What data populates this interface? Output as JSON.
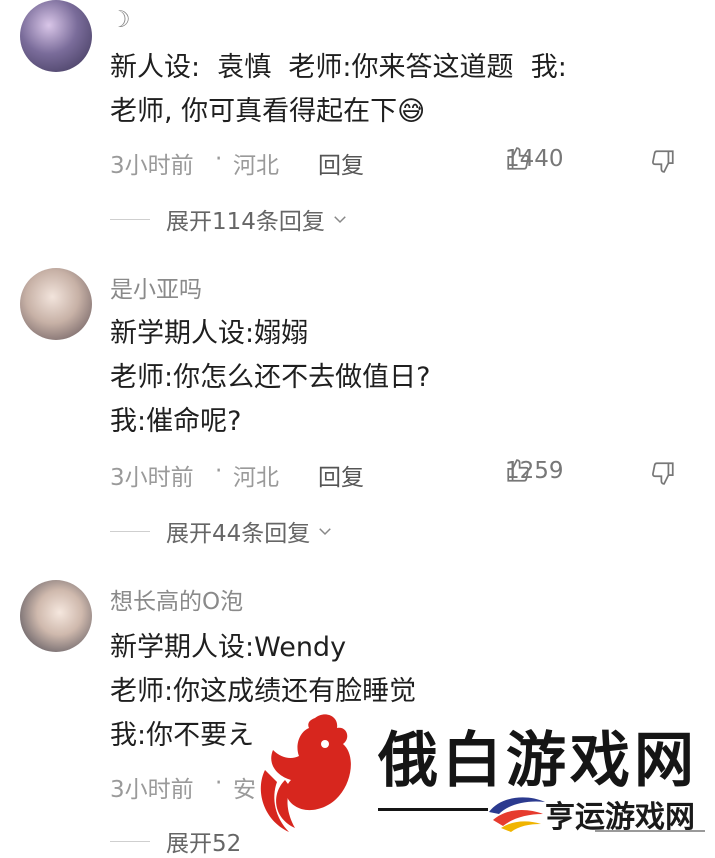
{
  "comments": [
    {
      "username": "☽",
      "text": "新人设:  袁慎  老师:你来答这道题  我:\n老师, 你可真看得起在下😅",
      "time": "3小时前",
      "location": "河北",
      "reply_label": "回复",
      "likes": "1440",
      "expand_label": "展开114条回复"
    },
    {
      "username": "是小亚吗",
      "text": "新学期人设:嫋嫋\n老师:你怎么还不去做值日?\n我:催命呢?",
      "time": "3小时前",
      "location": "河北",
      "reply_label": "回复",
      "likes": "1259",
      "expand_label": "展开44条回复"
    },
    {
      "username": "想长高的O泡",
      "text": "新学期人设:Wendy\n老师:你这成绩还有脸睡觉\n我:你不要え",
      "time": "3小时前",
      "location": "安",
      "expand_label": "展开52"
    }
  ],
  "separator": "·",
  "watermark": {
    "title": "俄白游戏网",
    "subtitle": "亨运游戏网"
  },
  "colors": {
    "text": "#1f1f1f",
    "muted": "#9a9a9a",
    "watermark_red": "#d7261e"
  }
}
